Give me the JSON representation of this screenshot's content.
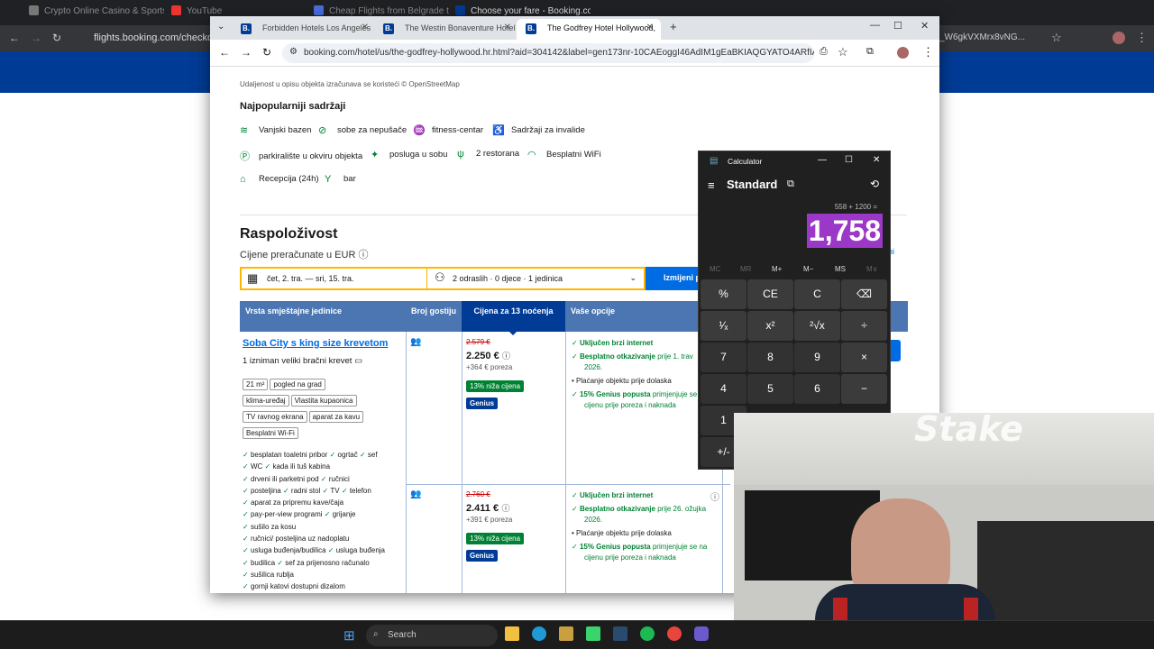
{
  "bg_browser": {
    "tabs": [
      "Crypto Online Casino & Sports",
      "YouTube",
      "Cheap Flights from Belgrade to",
      "Choose your fare - Booking.co"
    ],
    "url": "flights.booking.com/checkout/",
    "url_tail": "_W6gkVXMrx8vNG..."
  },
  "front_browser": {
    "tabs": [
      "Forbidden Hotels Los Angeles",
      "The Westin Bonaventure Hotel",
      "The Godfrey Hotel Hollywood,"
    ],
    "url": "booking.com/hotel/us/the-godfrey-hollywood.hr.html?aid=304142&label=gen173nr-10CAEoggI46AdIM1gEaBKIAQGYATO4ARfIAQzYA..."
  },
  "page": {
    "distance_note": "Udaljenost u opisu objekta izračunava se koristeći © OpenStreetMap",
    "facilities_title": "Najpopularniji sadržaji",
    "facilities": [
      "Vanjski bazen",
      "sobe za nepušače",
      "fitness-centar",
      "Sadržaji za invalide",
      "parkiralište u okviru objekta",
      "posluga u sobu",
      "2 restorana",
      "Besplatni WiFi",
      "Recepcija (24h)",
      "bar"
    ],
    "availability_title": "Raspoloživost",
    "currency_note": "Cijene preračunate u EUR",
    "date_range": "čet, 2. tra.  —  sri, 15. tra.",
    "guests": "2 odraslih · 0 djece · 1 jedinica",
    "change_search": "Izmijeni p",
    "table_headers": [
      "Vrsta smještajne jedinice",
      "Broj gostiju",
      "Cijena za 13 noćenja",
      "Vaše opcije"
    ],
    "room_name": "Soba City s king size krevetom",
    "bed": "1 izniman veliki bračni krevet",
    "tags": [
      "21 m²",
      "pogled na grad",
      "klima-uređaj",
      "Vlastita kupaonica",
      "TV ravnog ekrana",
      "aparat za kavu",
      "Besplatni Wi-Fi"
    ],
    "amenities": [
      "besplatan toaletni pribor",
      "ogrtač",
      "sef",
      "WC",
      "kada ili tuš kabina",
      "drveni ili parketni pod",
      "ručnici",
      "posteljina",
      "radni stol",
      "TV",
      "telefon",
      "aparat za pripremu kave/čaja",
      "pay-per-view programi",
      "grijanje",
      "sušilo za kosu",
      "ručnici/ posteljina uz nadoplatu",
      "usluga buđenja/budilica",
      "usluga buđenja",
      "budilica",
      "sef za prijenosno računalo",
      "sušilica rublja",
      "gornji katovi dostupni dizalom"
    ],
    "offers": [
      {
        "old": "2.579 €",
        "price": "2.250 €",
        "tax": "+364 € poreza",
        "discount": "13% niža cijena",
        "genius": "Genius",
        "opts": [
          "Uključen brzi internet",
          "Besplatno otkazivanje",
          "prije 1. trav",
          "2026.",
          "Plaćanje objektu prije dolaska",
          "15% Genius popusta",
          "primjenjuje se",
          "cijenu prije poreza i naknada"
        ]
      },
      {
        "old": "2.760 €",
        "price": "2.411 €",
        "tax": "+391 € poreza",
        "discount": "13% niža cijena",
        "genius": "Genius",
        "opts": [
          "Uključen brzi internet",
          "Besplatno otkazivanje",
          "prije 26. ožujka",
          "2026.",
          "Plaćanje objektu prije dolaska",
          "15% Genius popusta",
          "primjenjuje se na",
          "cijenu prije poreza i naknada"
        ]
      }
    ],
    "side_link": "eni"
  },
  "calculator": {
    "title": "Calculator",
    "mode": "Standard",
    "expression": "558 + 1200 =",
    "result": "1,758",
    "memory": [
      "MC",
      "MR",
      "M+",
      "M−",
      "MS",
      "M∨"
    ],
    "keys": [
      "%",
      "CE",
      "C",
      "⌫",
      "¹⁄ₓ",
      "x²",
      "²√x",
      "÷",
      "7",
      "8",
      "9",
      "×",
      "4",
      "5",
      "6",
      "−",
      "1",
      "+/-"
    ]
  },
  "taskbar": {
    "search": "Search"
  },
  "stake_logo": "Stake"
}
